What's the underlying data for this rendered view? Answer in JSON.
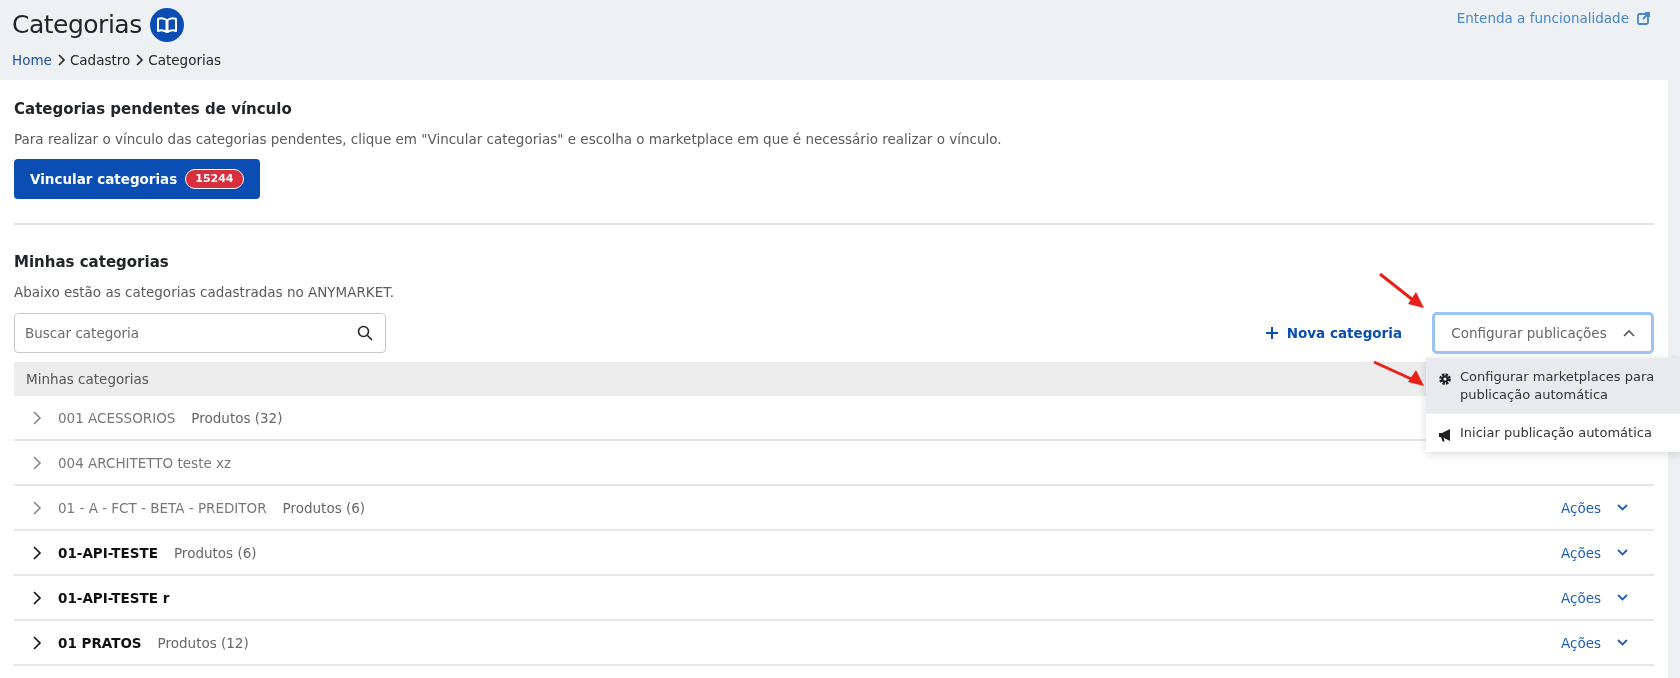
{
  "header": {
    "title": "Categorias",
    "help_link": "Entenda a funcionalidade",
    "breadcrumb": [
      {
        "label": "Home",
        "link": true
      },
      {
        "label": "Cadastro",
        "link": false
      },
      {
        "label": "Categorias",
        "link": false
      }
    ]
  },
  "pending": {
    "title": "Categorias pendentes de vínculo",
    "description": "Para realizar o vínculo das categorias pendentes, clique em \"Vincular categorias\" e escolha o marketplace em que é necessário realizar o vínculo.",
    "button": "Vincular categorias",
    "badge": "15244"
  },
  "my_categories": {
    "title": "Minhas categorias",
    "description": "Abaixo estão as categorias cadastradas no ANYMARKET.",
    "search": {
      "placeholder": "Buscar categoria"
    },
    "new_button": "Nova categoria",
    "config_button": {
      "label": "Configurar publicações",
      "expanded": true
    },
    "menu": [
      {
        "label": "Configurar marketplaces para publicação automática",
        "kind": "gear",
        "selected": true
      },
      {
        "label": "Iniciar publicação automática",
        "kind": "megaphone",
        "selected": false
      }
    ],
    "table_header": "Minhas categorias",
    "rows": [
      {
        "name": "001 ACESSORIOS",
        "products": "Produtos (32)",
        "dimmed": true
      },
      {
        "name": "004 ARCHITETTO teste xz",
        "dimmed": true
      },
      {
        "name": "01 - A - FCT - BETA - PREDITOR",
        "products": "Produtos (6)",
        "dimmed": true,
        "actions": "Ações"
      },
      {
        "name": "01-API-TESTE",
        "products": "Produtos (6)",
        "dimmed": false,
        "actions": "Ações"
      },
      {
        "name": "01-API-TESTE r",
        "dimmed": false,
        "actions": "Ações"
      },
      {
        "name": "01 PRATOS",
        "products": "Produtos (12)",
        "dimmed": false,
        "actions": "Ações"
      }
    ]
  },
  "annotations": [
    {
      "kind": "arrow"
    },
    {
      "kind": "arrow"
    }
  ]
}
